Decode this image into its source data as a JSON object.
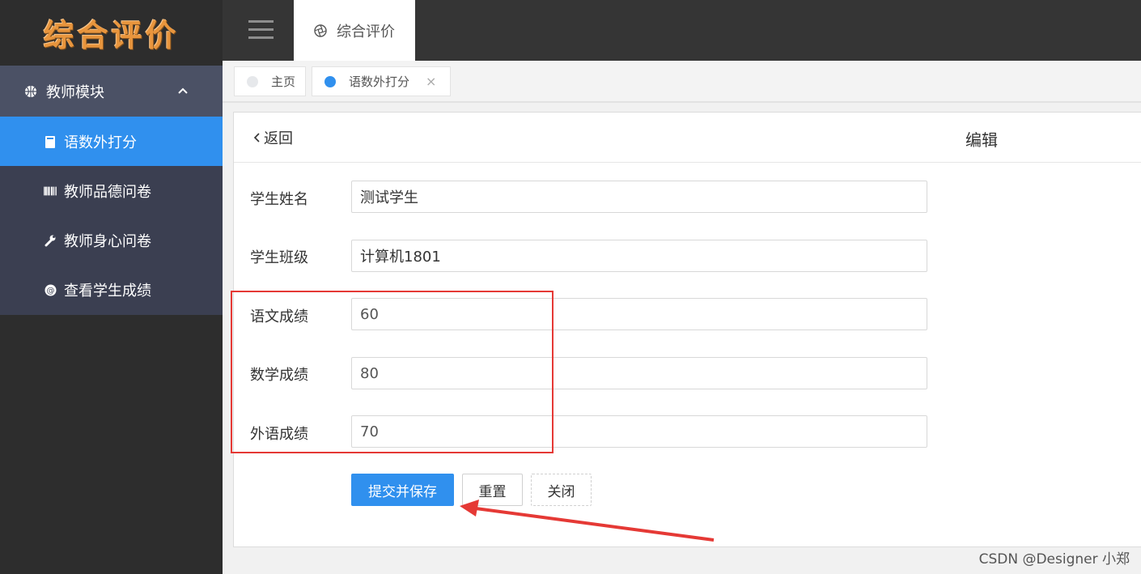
{
  "app": {
    "logo_text": "综合评价"
  },
  "sidebar": {
    "module": {
      "label": "教师模块",
      "icon": "basketball-icon"
    },
    "items": [
      {
        "label": "语数外打分",
        "icon": "document-icon",
        "active": true
      },
      {
        "label": "教师品德问卷",
        "icon": "barcode-icon",
        "active": false
      },
      {
        "label": "教师身心问卷",
        "icon": "wrench-icon",
        "active": false
      },
      {
        "label": "查看学生成绩",
        "icon": "at-icon",
        "active": false
      }
    ]
  },
  "topbar": {
    "tab_label": "综合评价",
    "tab_icon": "aperture-icon"
  },
  "page_tabs": [
    {
      "label": "主页",
      "dot_color": "#e6e8eb"
    },
    {
      "label": "语数外打分",
      "dot_color": "#3090ee",
      "close": "×"
    }
  ],
  "panel": {
    "back_label": "返回",
    "title": "编辑"
  },
  "form": {
    "fields": [
      {
        "label": "学生姓名",
        "value": "测试学生"
      },
      {
        "label": "学生班级",
        "value": "计算机1801"
      },
      {
        "label": "语文成绩",
        "value": "60"
      },
      {
        "label": "数学成绩",
        "value": "80"
      },
      {
        "label": "外语成绩",
        "value": "70"
      }
    ],
    "buttons": {
      "submit": "提交并保存",
      "reset": "重置",
      "close": "关闭"
    }
  },
  "watermark": "CSDN @Designer 小郑",
  "colors": {
    "accent": "#3090ee",
    "annotation": "#e53935",
    "logo": "#e8953d"
  }
}
